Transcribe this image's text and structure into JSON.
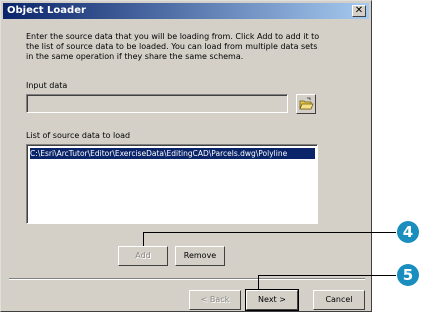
{
  "window": {
    "title": "Object Loader",
    "close_glyph": "✕"
  },
  "description": "Enter the source data that you will be loading from. Click Add to add it to the list of source data to be loaded. You can load from multiple data sets in the same operation if they share the same schema.",
  "input": {
    "label": "Input data",
    "value": "",
    "browse_icon": "open-folder-icon"
  },
  "source_list": {
    "label": "List of source data to load",
    "items": [
      "C:\\Esri\\ArcTutor\\Editor\\ExerciseData\\EditingCAD\\Parcels.dwg\\Polyline"
    ]
  },
  "buttons": {
    "add": "Add",
    "remove": "Remove",
    "back": "< Back",
    "next": "Next >",
    "cancel": "Cancel"
  },
  "callouts": [
    {
      "number": "4"
    },
    {
      "number": "5"
    }
  ],
  "colors": {
    "title_bar": "#0a246a",
    "dialog_face": "#d4d0c8",
    "selection": "#0a246a",
    "callout_badge": "#1a8fbf"
  }
}
